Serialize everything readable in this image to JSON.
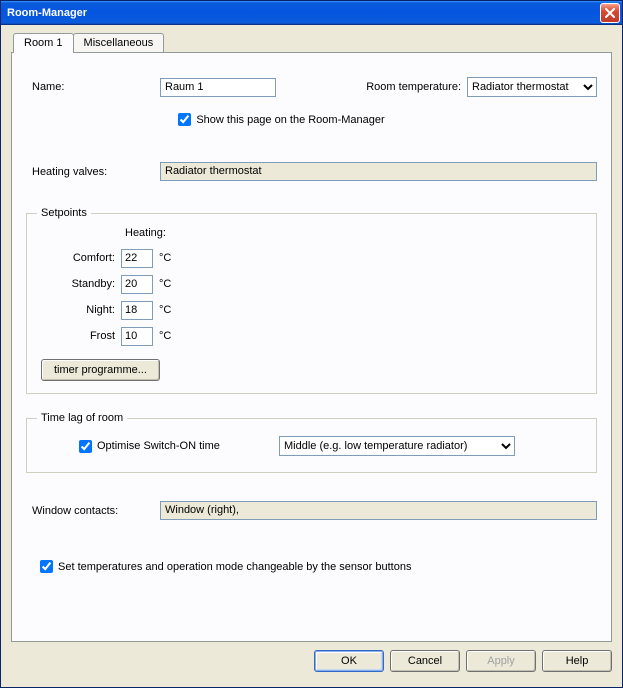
{
  "window": {
    "title": "Room-Manager"
  },
  "tabs": [
    {
      "label": "Room 1"
    },
    {
      "label": "Miscellaneous"
    }
  ],
  "name_section": {
    "label": "Name:",
    "value": "Raum 1",
    "room_temp_label": "Room temperature:",
    "room_temp_value": "Radiator thermostat",
    "show_page_label": "Show this page on the Room-Manager",
    "show_page_checked": true
  },
  "valves": {
    "label": "Heating valves:",
    "value": "Radiator thermostat"
  },
  "setpoints": {
    "legend": "Setpoints",
    "heating_label": "Heating:",
    "unit": "°C",
    "rows": [
      {
        "label": "Comfort:",
        "value": "22"
      },
      {
        "label": "Standby:",
        "value": "20"
      },
      {
        "label": "Night:",
        "value": "18"
      },
      {
        "label": "Frost",
        "value": "10"
      }
    ],
    "timer_button": "timer programme..."
  },
  "timelag": {
    "legend": "Time lag of room",
    "optimise_label": "Optimise Switch-ON time",
    "optimise_checked": true,
    "combo_value": "Middle (e.g. low temperature radiator)"
  },
  "window_contacts": {
    "label": "Window contacts:",
    "value": "Window  (right),"
  },
  "sensor_checkbox": {
    "label": "Set temperatures and operation mode changeable by the sensor buttons",
    "checked": true
  },
  "buttons": {
    "ok": "OK",
    "cancel": "Cancel",
    "apply": "Apply",
    "help": "Help"
  }
}
